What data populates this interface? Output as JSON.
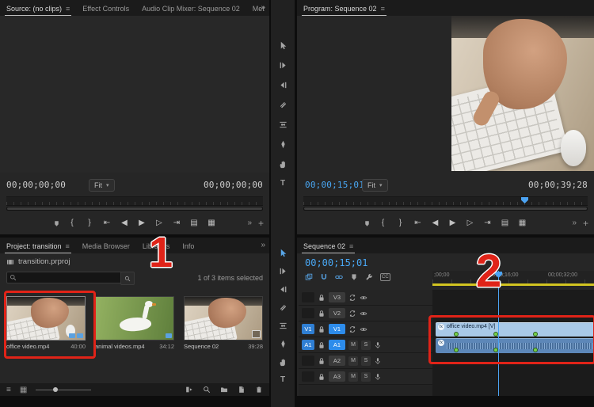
{
  "glyphs": {
    "menu": "≡",
    "overflow": "»",
    "caret": "▾",
    "plus": "+",
    "mark_in": "{",
    "mark_out": "}",
    "go_to_in": "⇤",
    "step_back": "◀",
    "play": "▶",
    "step_forward": "▷",
    "go_to_out": "⇥",
    "insert": "▤",
    "overwrite": "▦",
    "list_view": "≡",
    "thumbnail_view": "▦",
    "cc": "CC",
    "type_tool": "T"
  },
  "source_monitor": {
    "tabs": [
      "Source: (no clips)",
      "Effect Controls",
      "Audio Clip Mixer: Sequence 02",
      "Met"
    ],
    "timecode_left": "00;00;00;00",
    "zoom_select": "Fit",
    "timecode_right": "00;00;00;00"
  },
  "program_monitor": {
    "tab": "Program: Sequence 02",
    "timecode_current": "00;00;15;01",
    "zoom_select": "Fit",
    "timecode_out": "00;00;39;28"
  },
  "project_panel": {
    "tabs": [
      "Project: transition",
      "Media Browser",
      "Libraries",
      "Info"
    ],
    "file_name": "transition.prproj",
    "selection_status": "1 of 3 items selected",
    "items": [
      {
        "name": "office video.mp4",
        "duration": "40:00"
      },
      {
        "name": "animal videos.mp4",
        "duration": "34:12"
      },
      {
        "name": "Sequence 02",
        "duration": "39:28"
      }
    ]
  },
  "timeline": {
    "tab": "Sequence 02",
    "timecode": "00;00;15;01",
    "ruler_labels": [
      ";00;00",
      "00;00;16;00",
      "00;00;32;00"
    ],
    "video_tracks": [
      "V3",
      "V2",
      "V1"
    ],
    "audio_tracks": [
      "A1",
      "A2",
      "A3"
    ],
    "source_patch_video": "V1",
    "source_patch_audio": "A1",
    "mute_label": "M",
    "solo_label": "S",
    "video_clip_label": "office video.mp4 [V]",
    "fx_badge": "fx"
  },
  "annotations": {
    "step_1": "1",
    "step_2": "2"
  },
  "colors": {
    "accent_blue": "#2d8ceb",
    "timecode_blue": "#49a8f5",
    "annotation_red": "#e02318",
    "work_area_yellow": "#d2c421",
    "video_clip": "#a9c9e8",
    "audio_clip": "#5d87b8",
    "keyframe_green": "#76cf4a"
  }
}
